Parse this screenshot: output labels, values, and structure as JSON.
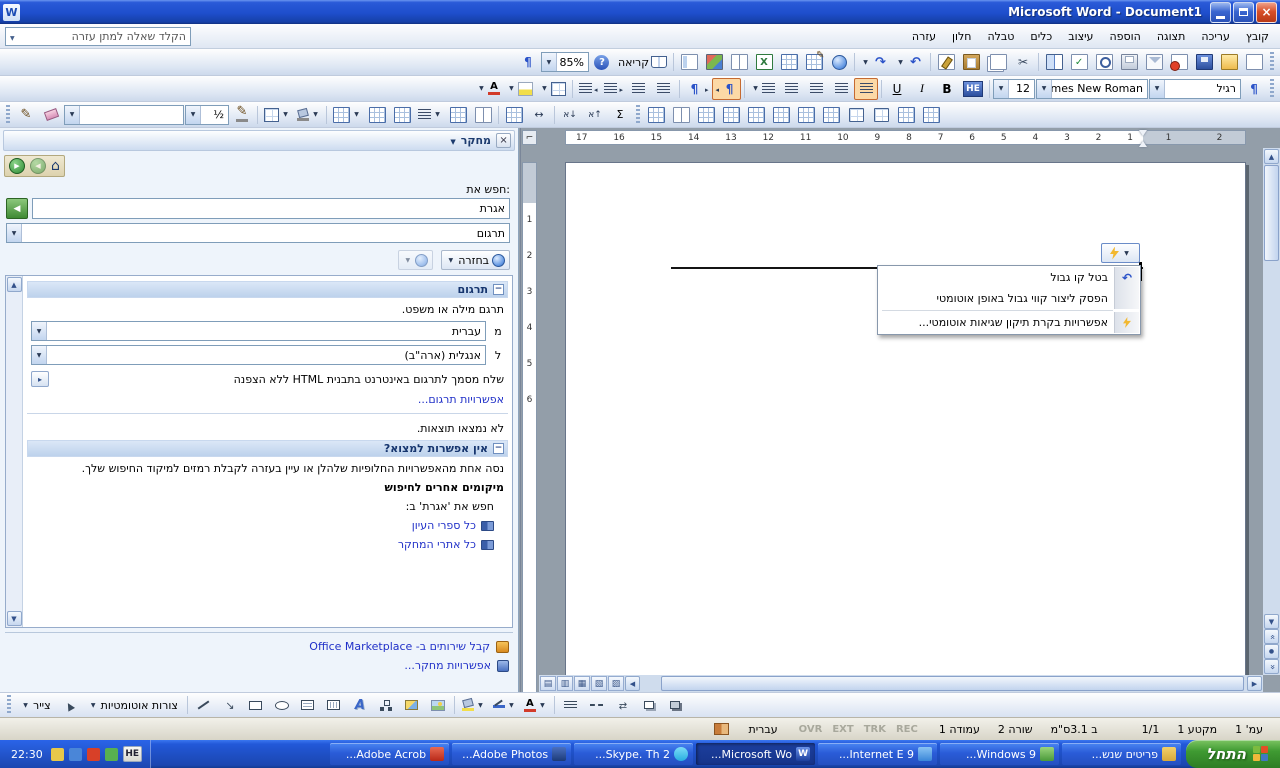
{
  "window": {
    "title": "Microsoft Word - Document1"
  },
  "menu_bar": {
    "question_placeholder": "הקלד שאלה למתן עזרה",
    "menus": [
      "קובץ",
      "עריכה",
      "תצוגה",
      "הוספה",
      "עיצוב",
      "כלים",
      "טבלה",
      "חלון",
      "עזרה"
    ]
  },
  "standard_toolbar": {
    "zoom_value": "85%",
    "read_label": "קריאה"
  },
  "formatting_toolbar": {
    "style_value": "רגיל",
    "font_value": "Times New Roman",
    "size_value": "12",
    "complex_label": "HE",
    "bold": "B",
    "italic": "I",
    "underline": "U",
    "font_color_letter": "A"
  },
  "tables_toolbar": {
    "line_weight": "½",
    "autosum": "Σ"
  },
  "task_pane": {
    "title": "מחקר",
    "search_label": "חפש את:",
    "search_value": "אגרת",
    "scope_value": "תרגום",
    "back_label": "בחזרה",
    "translation": {
      "header": "תרגום",
      "description": "תרגם מילה או משפט.",
      "from_label": "מ",
      "from_value": "עברית",
      "to_label": "ל",
      "to_value": "אנגלית (ארה\"ב)",
      "send_document": "שלח מסמך לתרגום באינטרנט בתבנית HTML ללא הצפנה",
      "options_link": "אפשרויות תרגום..."
    },
    "no_results": "לא נמצאו תוצאות.",
    "cant_find": {
      "header": "אין אפשרות למצוא?",
      "hint": "נסה אחת מהאפשרויות החלופיות שלהלן או עיין בעזרה לקבלת רמזים למיקוד החיפוש שלך.",
      "other_locations": "מיקומים אחרים לחיפוש",
      "search_for": "חפש את 'אגרת' ב:",
      "links": [
        "כל ספרי העיון",
        "כל אתרי המחקר"
      ]
    },
    "footer": {
      "marketplace": "קבל שירותים ב- Office Marketplace",
      "options": "אפשרויות מחקר..."
    }
  },
  "document": {
    "h_ruler_main": [
      "17",
      "16",
      "15",
      "14",
      "13",
      "12",
      "11",
      "10",
      "9",
      "8",
      "7",
      "6",
      "5",
      "4",
      "3",
      "2",
      "1"
    ],
    "h_ruler_margin": [
      "1",
      "2"
    ],
    "v_ruler": [
      "1",
      "2",
      "3",
      "4",
      "5",
      "6"
    ],
    "autocorrect_menu": {
      "items": [
        "בטל קו גבול",
        "הפסק ליצור קווי גבול באופן אוטומטי",
        "אפשרויות בקרת תיקון שגיאות אוטומטי..."
      ]
    }
  },
  "drawing_toolbar": {
    "draw_label": "צייר",
    "autoshapes_label": "צורות אוטומטיות"
  },
  "status_bar": {
    "page": "עמ' 1",
    "section": "מקטע 1",
    "page_of": "1/1",
    "position": "ב 3.1ס\"מ",
    "line": "שורה 2",
    "column": "עמודה 1",
    "indicators": [
      "REC",
      "TRK",
      "EXT",
      "OVR"
    ],
    "language": "עברית"
  },
  "taskbar": {
    "start_label": "התחל",
    "tray_time": "22:30",
    "tray_language": "HE",
    "buttons": [
      {
        "label": "פריטים שנש..."
      },
      {
        "label": "Windows 9..."
      },
      {
        "label": "Internet E 9..."
      },
      {
        "label": "Microsoft Wo...",
        "active": true
      },
      {
        "label": "Skype. Th 2..."
      },
      {
        "label": "Adobe Photos..."
      },
      {
        "label": "Adobe Acrob..."
      }
    ]
  }
}
